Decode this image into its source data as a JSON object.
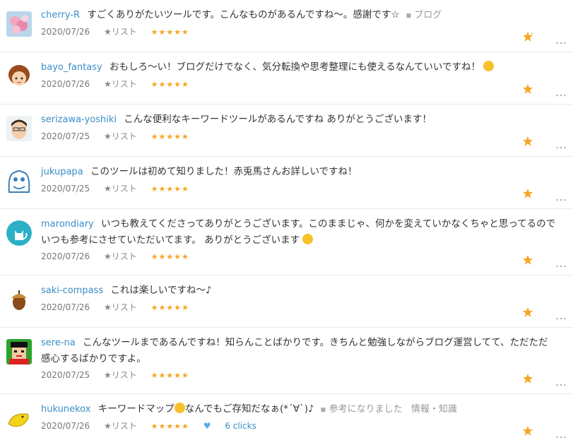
{
  "comments": [
    {
      "user": "cherry-R",
      "text": "すごくありがたいツールです。こんなものがあるんですね〜。感謝です☆",
      "tag": "ブログ",
      "date": "2020/07/26",
      "list_label": "★リスト",
      "stars": "★★★★★",
      "avatar_icon": "cherry-blossom-avatar"
    },
    {
      "user": "bayo_fantasy",
      "text": "おもしろ〜い！ブログだけでなく、気分転換や思考整理にも使えるなんていいですね！",
      "date": "2020/07/26",
      "list_label": "★リスト",
      "stars": "★★★★★",
      "avatar_icon": "girl-face-avatar"
    },
    {
      "user": "serizawa-yoshiki",
      "text": "こんな便利なキーワードツールがあるんですね ありがとうございます！",
      "date": "2020/07/25",
      "list_label": "★リスト",
      "stars": "★★★★★",
      "avatar_icon": "man-face-avatar"
    },
    {
      "user": "jukupapa",
      "text": "このツールは初めて知りました！赤兎馬さんお詳しいですね！",
      "date": "2020/07/25",
      "list_label": "★リスト",
      "stars": "★★★★★",
      "avatar_icon": "blue-monster-avatar"
    },
    {
      "user": "marondiary",
      "text": "いつも教えてくださってありがとうございます。このままじゃ、何かを変えていかなくちゃと思ってるのでいつも参考にさせていただいてます。 ありがとうございます",
      "date": "2020/07/26",
      "list_label": "★リスト",
      "stars": "★★★★★",
      "avatar_icon": "cat-avatar"
    },
    {
      "user": "saki-compass",
      "text": "これは楽しいですね〜♪",
      "date": "2020/07/26",
      "list_label": "★リスト",
      "stars": "★★★★★",
      "avatar_icon": "acorn-avatar"
    },
    {
      "user": "sere-na",
      "text": "こんなツールまであるんですね！知らんことばかりです。きちんと勉強しながらブログ運営してて、ただただ感心するばかりですよ。",
      "date": "2020/07/25",
      "list_label": "★リスト",
      "stars": "★★★★★",
      "avatar_icon": "pixel-face-avatar"
    },
    {
      "user": "hukunekox",
      "text": "キーワードマップ",
      "text_after_emoji": "なんでもご存知だなぁ(*´∀`)♪",
      "tag": "参考になりました",
      "tag_extra": "情報・知識",
      "date": "2020/07/26",
      "list_label": "★リスト",
      "stars": "★★★★★",
      "clicks": "6 clicks",
      "avatar_icon": "yellow-banana-avatar"
    }
  ],
  "colors": {
    "username": "#3a8ec7",
    "stars": "#f5a623",
    "divider": "#e9e9e9"
  }
}
